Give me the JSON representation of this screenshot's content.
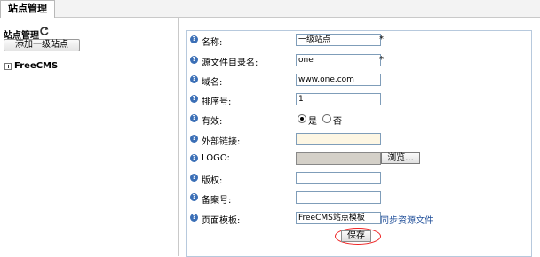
{
  "tab": {
    "label": "站点管理"
  },
  "sidebar": {
    "title": "站点管理",
    "add_button": "添加一级站点",
    "tree": [
      {
        "label": "FreeCMS"
      }
    ]
  },
  "form": {
    "name": {
      "label": "名称:",
      "value": "一级站点",
      "required": "*"
    },
    "source_dir": {
      "label": "源文件目录名:",
      "value": "one",
      "required": "*"
    },
    "domain": {
      "label": "域名:",
      "value": "www.one.com"
    },
    "order": {
      "label": "排序号:",
      "value": "1"
    },
    "enabled": {
      "label": "有效:",
      "yes": "是",
      "no": "否",
      "selected": "是"
    },
    "external_link": {
      "label": "外部链接:",
      "value": ""
    },
    "logo": {
      "label": "LOGO:",
      "value": "",
      "browse": "浏览..."
    },
    "copyright": {
      "label": "版权:",
      "value": ""
    },
    "icp": {
      "label": "备案号:",
      "value": ""
    },
    "template": {
      "label": "页面模板:",
      "value": "FreeCMS站点模板",
      "sync_link": "同步资源文件"
    },
    "save": "保存",
    "help_glyph": "?"
  },
  "colors": {
    "panel_border": "#b7c9dd",
    "link": "#1f4e99",
    "highlight_circle": "#e22222",
    "external_bg": "#fdf6e3",
    "logo_bg": "#d4d0c8"
  }
}
